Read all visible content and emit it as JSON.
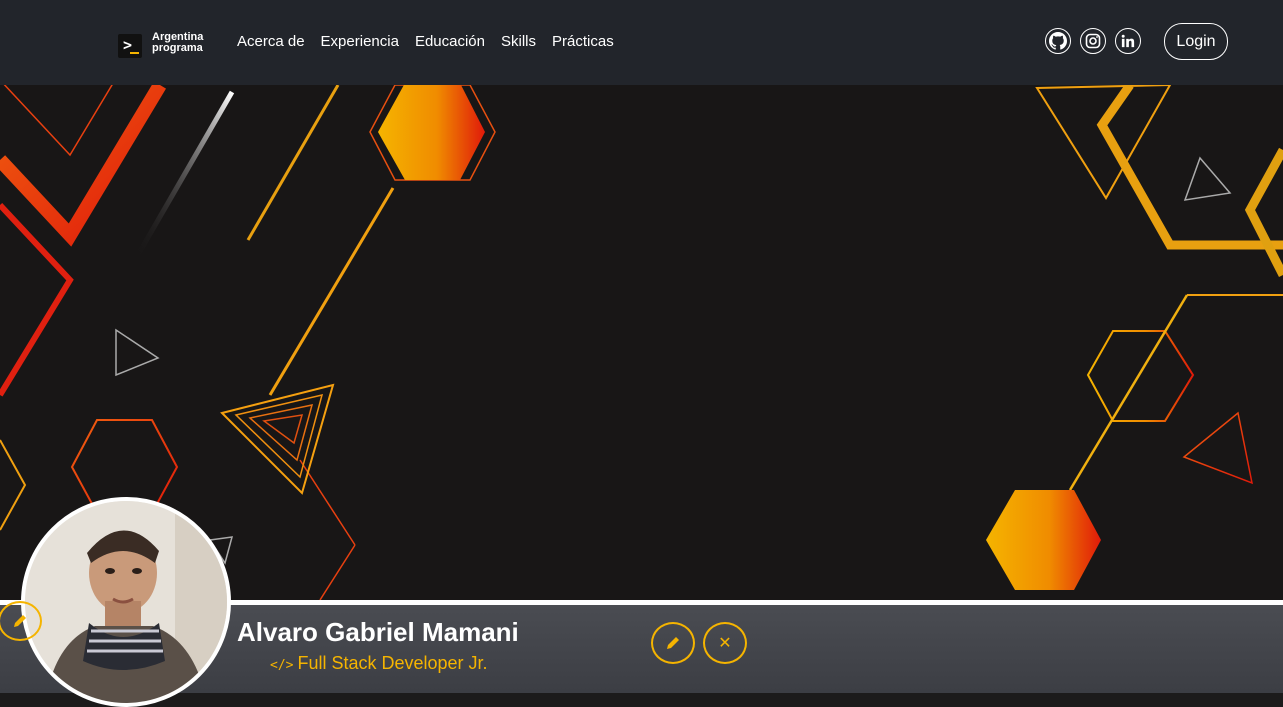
{
  "brand": {
    "line1": "Argentina",
    "line2": "programa",
    "prompt_icon": "terminal-prompt-icon"
  },
  "nav": {
    "items": [
      {
        "label": "Acerca de"
      },
      {
        "label": "Experiencia"
      },
      {
        "label": "Educación"
      },
      {
        "label": "Skills"
      },
      {
        "label": "Prácticas"
      }
    ]
  },
  "social": [
    "github-icon",
    "instagram-icon",
    "linkedin-icon"
  ],
  "header": {
    "login_label": "Login"
  },
  "profile": {
    "name": "Alvaro Gabriel Mamani",
    "role": "Full Stack Developer Jr.",
    "role_icon": "</>",
    "edit_icon": "pencil-icon",
    "delete_icon": "close-icon",
    "delete_glyph": "✕"
  },
  "colors": {
    "navbar": "#22252b",
    "accent": "#f5b400",
    "banner_bg": "#181616",
    "profile_bar": "#44464c"
  }
}
